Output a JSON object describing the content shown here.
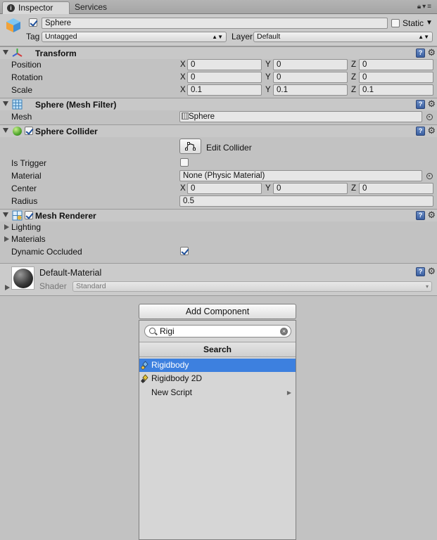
{
  "tabs": [
    {
      "label": "Inspector",
      "active": true
    },
    {
      "label": "Services",
      "active": false
    }
  ],
  "gameobject": {
    "name": "Sphere",
    "active": true,
    "static_label": "Static",
    "static": false,
    "tag_label": "Tag",
    "tag_value": "Untagged",
    "layer_label": "Layer",
    "layer_value": "Default"
  },
  "transform": {
    "title": "Transform",
    "rows": [
      {
        "label": "Position",
        "x": "0",
        "y": "0",
        "z": "0"
      },
      {
        "label": "Rotation",
        "x": "0",
        "y": "0",
        "z": "0"
      },
      {
        "label": "Scale",
        "x": "0.1",
        "y": "0.1",
        "z": "0.1"
      }
    ],
    "axis": {
      "x": "X",
      "y": "Y",
      "z": "Z"
    }
  },
  "mesh_filter": {
    "title": "Sphere (Mesh Filter)",
    "mesh_label": "Mesh",
    "mesh_value": "Sphere"
  },
  "sphere_collider": {
    "title": "Sphere Collider",
    "enabled": true,
    "edit_label": "Edit Collider",
    "is_trigger_label": "Is Trigger",
    "is_trigger": false,
    "material_label": "Material",
    "material_value": "None (Physic Material)",
    "center_label": "Center",
    "center": {
      "x": "0",
      "y": "0",
      "z": "0"
    },
    "radius_label": "Radius",
    "radius_value": "0.5"
  },
  "mesh_renderer": {
    "title": "Mesh Renderer",
    "enabled": true,
    "lighting_label": "Lighting",
    "materials_label": "Materials",
    "dynamic_occluded_label": "Dynamic Occluded",
    "dynamic_occluded": true
  },
  "material": {
    "name": "Default-Material",
    "shader_label": "Shader",
    "shader_value": "Standard"
  },
  "add_component": {
    "button_label": "Add Component",
    "search_value": "Rigi",
    "popup_title": "Search",
    "items": [
      {
        "label": "Rigidbody",
        "icon": "rigidbody-icon",
        "selected": true
      },
      {
        "label": "Rigidbody 2D",
        "icon": "rigidbody-2d-icon",
        "selected": false
      },
      {
        "label": "New Script",
        "icon": "",
        "selected": false,
        "submenu": true
      }
    ]
  },
  "colors": {
    "panel": "#c2c2c2",
    "selection": "#3d80df",
    "help_icon": "#4a6fb0"
  }
}
